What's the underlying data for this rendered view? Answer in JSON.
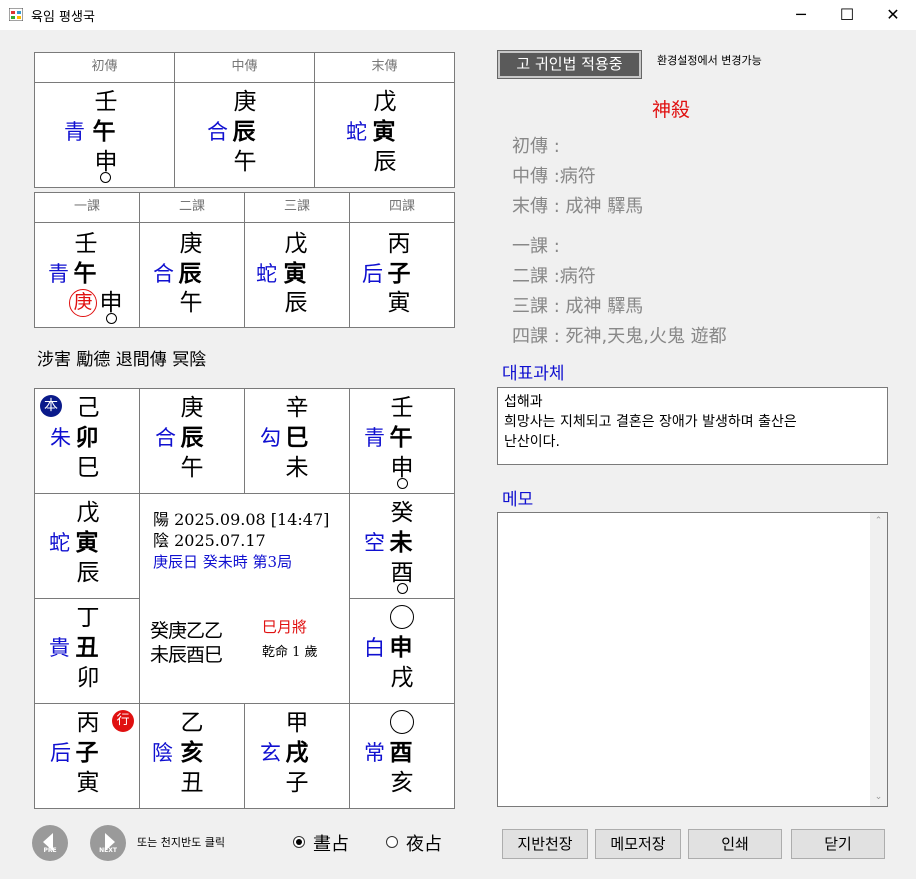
{
  "window": {
    "title": "육임 평생국",
    "min": "─",
    "max": "☐",
    "close": "✕"
  },
  "chuan": {
    "headers": [
      "初傳",
      "中傳",
      "末傳"
    ],
    "cols": [
      {
        "top": "壬",
        "general": "青",
        "branch": "午",
        "bottom": "申",
        "void": true
      },
      {
        "top": "庚",
        "general": "合",
        "branch": "辰",
        "bottom": "午",
        "void": false
      },
      {
        "top": "戊",
        "general": "蛇",
        "branch": "寅",
        "bottom": "辰",
        "void": false
      }
    ]
  },
  "ke": {
    "headers": [
      "一課",
      "二課",
      "三課",
      "四課"
    ],
    "cols": [
      {
        "top": "壬",
        "general": "青",
        "branch": "午",
        "stem_mark": "庚",
        "bottom": "申",
        "void": true
      },
      {
        "top": "庚",
        "general": "合",
        "branch": "辰",
        "bottom": "午"
      },
      {
        "top": "戊",
        "general": "蛇",
        "branch": "寅",
        "bottom": "辰"
      },
      {
        "top": "丙",
        "general": "后",
        "branch": "子",
        "bottom": "寅"
      }
    ]
  },
  "pattern": "涉害 勵德 退間傳 冥陰",
  "board": {
    "row1": [
      {
        "badge": "本",
        "top": "己",
        "general": "朱",
        "branch": "卯",
        "bottom": "巳"
      },
      {
        "top": "庚",
        "general": "合",
        "branch": "辰",
        "bottom": "午"
      },
      {
        "top": "辛",
        "general": "勾",
        "branch": "巳",
        "bottom": "未"
      },
      {
        "top": "壬",
        "general": "青",
        "branch": "午",
        "bottom": "申",
        "void": true
      }
    ],
    "left": [
      {
        "top": "戊",
        "general": "蛇",
        "branch": "寅",
        "bottom": "辰"
      },
      {
        "top": "丁",
        "general": "貴",
        "branch": "丑",
        "bottom": "卯"
      }
    ],
    "right": [
      {
        "top": "癸",
        "general": "空",
        "branch": "未",
        "bottom": "酉",
        "void": true
      },
      {
        "general": "白",
        "branch": "申",
        "bottom": "戌"
      }
    ],
    "row4": [
      {
        "badge": "行",
        "top": "丙",
        "general": "后",
        "branch": "子",
        "bottom": "寅"
      },
      {
        "top": "乙",
        "general": "陰",
        "branch": "亥",
        "bottom": "丑"
      },
      {
        "top": "甲",
        "general": "玄",
        "branch": "戌",
        "bottom": "子"
      },
      {
        "general": "常",
        "branch": "酉",
        "bottom": "亥"
      }
    ],
    "center": {
      "solar": "陽 2025.09.08 [14:47]",
      "lunar": "陰 2025.07.17",
      "daytime": "庚辰日 癸未時 第3局",
      "pillars_top": "癸庚乙乙",
      "pillars_bottom": "未辰酉巳",
      "month_general": "巳月將",
      "life": "乾命  1 歲"
    }
  },
  "nav": {
    "prev": "PRE",
    "next": "NEXT",
    "hint": "또는 천지반도 클릭",
    "day": "晝占",
    "night": "夜占",
    "selected": "day"
  },
  "right": {
    "gwin_button": "고 귀인법 적용중",
    "settings_note": "환경설정에서 변경가능",
    "shensha_title": "神殺",
    "shensha": [
      {
        "label": "初傳 :",
        "value": ""
      },
      {
        "label": "中傳 :",
        "value": "病符"
      },
      {
        "label": "末傳 :",
        "value": " 成神 驛馬"
      },
      {
        "label": "一課 :",
        "value": ""
      },
      {
        "label": "二課 :",
        "value": "病符"
      },
      {
        "label": "三課 :",
        "value": " 成神 驛馬"
      },
      {
        "label": "四課 :",
        "value": " 死神,天鬼,火鬼  遊都"
      }
    ],
    "task_title": "대표과체",
    "task_line1": "섭해과",
    "task_line2": "희망사는 지체되고 결혼은 장애가 발생하며 출산은",
    "task_line3": "난산이다.",
    "memo_title": "메모",
    "memo_value": ""
  },
  "buttons": {
    "chart": "지반천장",
    "save": "메모저장",
    "print": "인쇄",
    "close": "닫기"
  }
}
